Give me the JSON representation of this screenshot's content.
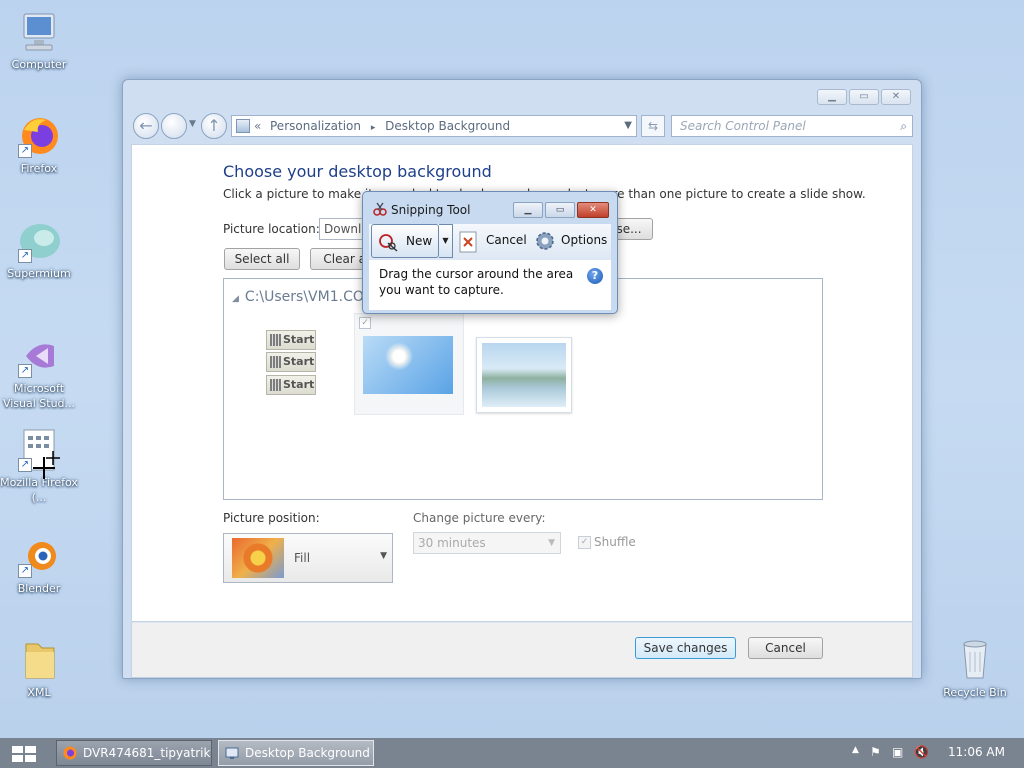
{
  "desktop": {
    "icons": [
      {
        "label": "Computer",
        "icon": "computer-icon"
      },
      {
        "label": "Firefox",
        "icon": "firefox-icon"
      },
      {
        "label": "Supermium",
        "icon": "supermium-icon"
      },
      {
        "label": "Microsoft Visual Stud...",
        "icon": "visual-studio-icon"
      },
      {
        "label": "Mozilla Firefox (...",
        "icon": "installer-icon"
      },
      {
        "label": "Blender",
        "icon": "blender-icon"
      },
      {
        "label": "XML",
        "icon": "folder-icon"
      },
      {
        "label": "Recycle Bin",
        "icon": "recycle-bin-icon"
      }
    ]
  },
  "window": {
    "address": {
      "prefix": "«",
      "crumb1": "Personalization",
      "sep": "▸",
      "crumb2": "Desktop Background"
    },
    "search_placeholder": "Search Control Panel",
    "heading": "Choose your desktop background",
    "subtext": "Click a picture to make it your desktop background, or select more than one picture to create a slide show.",
    "picture_location_label": "Picture location:",
    "picture_location_value": "Downloads",
    "browse_label": "Browse...",
    "select_all_label": "Select all",
    "clear_all_label": "Clear all",
    "folder_path": "C:\\Users\\VM1.COLI\\Downloads",
    "start_buttons": [
      "Start",
      "Start",
      "Start"
    ],
    "picture_position_label": "Picture position:",
    "picture_position_value": "Fill",
    "change_every_label": "Change picture every:",
    "change_every_value": "30 minutes",
    "shuffle_label": "Shuffle",
    "save_label": "Save changes",
    "cancel_label": "Cancel"
  },
  "snipping_tool": {
    "title": "Snipping Tool",
    "new_label": "New",
    "cancel_label": "Cancel",
    "options_label": "Options",
    "message": "Drag the cursor around the area you want to capture."
  },
  "taskbar": {
    "items": [
      {
        "label": "DVR474681_tipyatrik...",
        "icon": "firefox-icon"
      },
      {
        "label": "Desktop Background",
        "icon": "control-panel-icon"
      }
    ],
    "time": "11:06 AM"
  }
}
